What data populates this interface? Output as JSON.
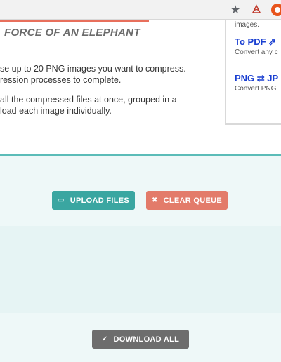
{
  "browser": {
    "star_icon": "★"
  },
  "hero": {
    "headline": "FORCE OF AN ELEPHANT"
  },
  "intro": {
    "line1": "se up to 20 PNG images you want to compress.",
    "line2": "ression processes to complete.",
    "line3": "all the compressed files at once, grouped in a",
    "line4": "load each image individually."
  },
  "sidebar": {
    "top_text": "images.",
    "link1": "To PDF ⇗",
    "link1_desc": "Convert any c",
    "link2": "PNG ⇄ JP",
    "link2_desc": "Convert PNG"
  },
  "actions": {
    "upload_label": "UPLOAD FILES",
    "upload_icon": "▭",
    "clear_label": "CLEAR QUEUE",
    "clear_icon": "✖",
    "download_label": "DOWNLOAD ALL",
    "download_icon": "✔"
  },
  "colors": {
    "upload": "#3aa6a1",
    "clear": "#e37b6a",
    "download": "#6d6d6d",
    "accent_rule": "#e86f5c",
    "link": "#1a3fd1"
  }
}
